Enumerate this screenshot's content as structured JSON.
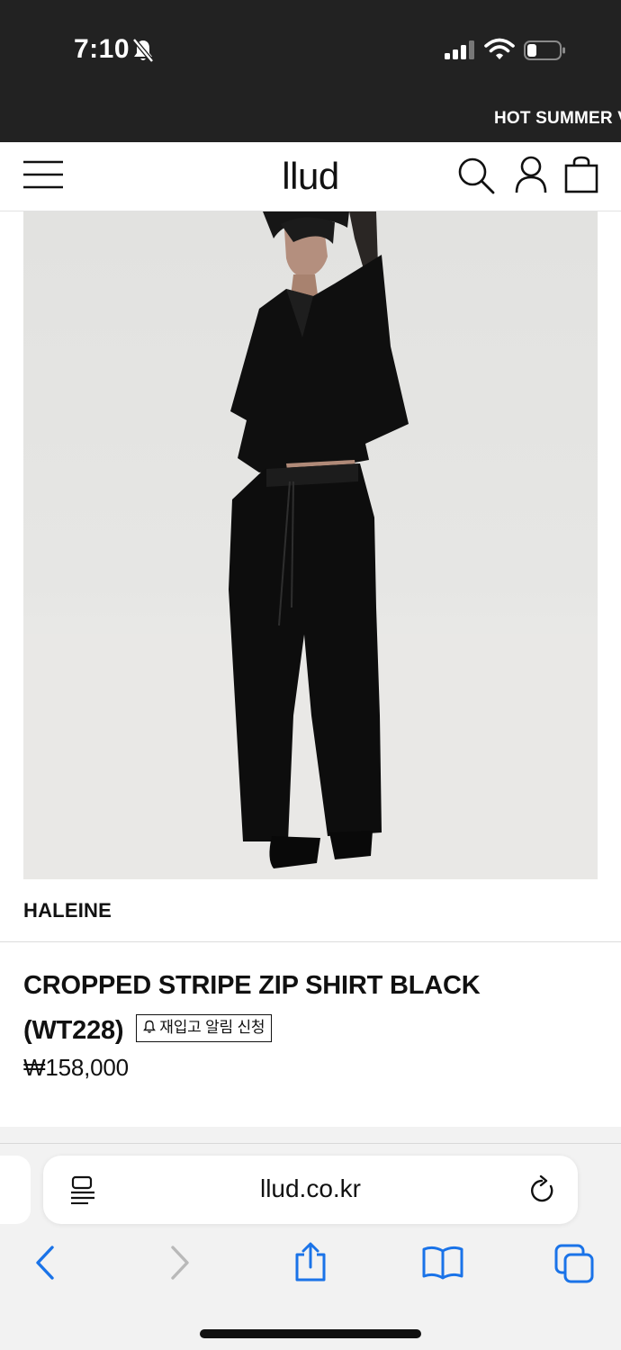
{
  "status_bar": {
    "time": "7:10"
  },
  "promo_banner": {
    "text": "HOT SUMMER V"
  },
  "header": {
    "logo": "llud"
  },
  "product": {
    "brand": "HALEINE",
    "title": "CROPPED STRIPE ZIP SHIRT BLACK (WT228)",
    "restock_button": "재입고 알림 신청",
    "price": "₩158,000"
  },
  "browser": {
    "url": "llud.co.kr"
  },
  "colors": {
    "status_bar_bg": "#222222",
    "header_bg": "#ffffff",
    "browser_accent": "#1a73e8",
    "browser_disabled": "#b9b9b9"
  }
}
